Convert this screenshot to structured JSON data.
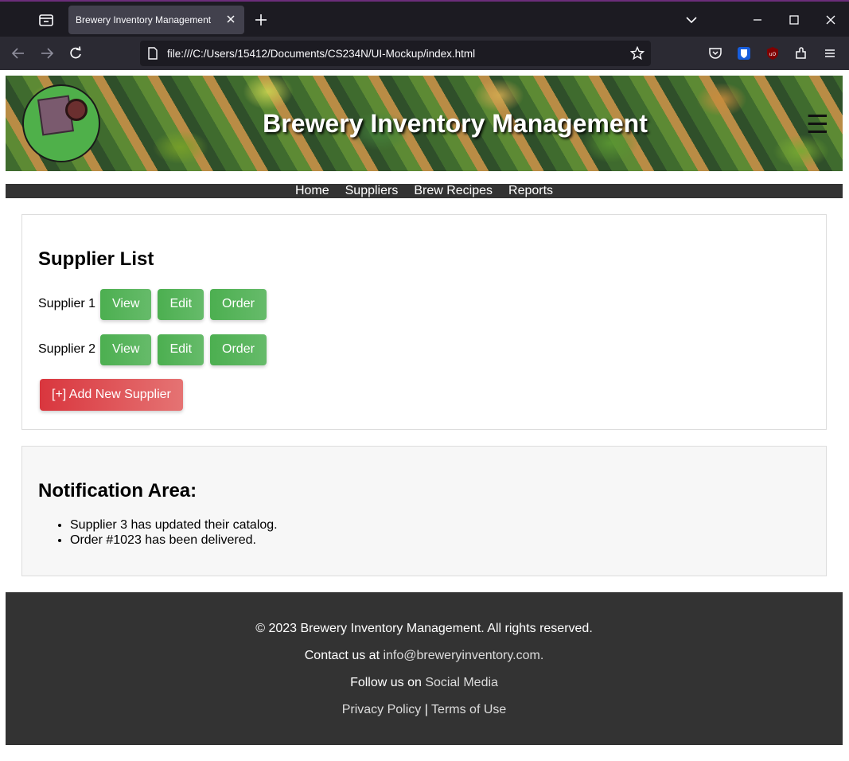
{
  "browser": {
    "tab_title": "Brewery Inventory Management",
    "url": "file:///C:/Users/15412/Documents/CS234N/UI-Mockup/index.html"
  },
  "header": {
    "title": "Brewery Inventory Management",
    "menu_glyph": "☰"
  },
  "nav": {
    "items": [
      "Home",
      "Suppliers",
      "Brew Recipes",
      "Reports"
    ]
  },
  "suppliers": {
    "heading": "Supplier List",
    "rows": [
      {
        "name": "Supplier 1",
        "view": "View",
        "edit": "Edit",
        "order": "Order"
      },
      {
        "name": "Supplier 2",
        "view": "View",
        "edit": "Edit",
        "order": "Order"
      }
    ],
    "add_label": "[+] Add New Supplier"
  },
  "notifications": {
    "heading": "Notification Area:",
    "items": [
      "Supplier 3 has updated their catalog.",
      "Order #1023 has been delivered."
    ]
  },
  "footer": {
    "copyright": "© 2023 Brewery Inventory Management. All rights reserved.",
    "contact_prefix": "Contact us at ",
    "contact_email": "info@breweryinventory.com",
    "contact_suffix": ".",
    "follow_prefix": "Follow us on ",
    "follow_link": "Social Media",
    "privacy": "Privacy Policy",
    "separator": " | ",
    "terms": "Terms of Use"
  },
  "colors": {
    "accent_green": "#4caf50",
    "accent_red": "#d9363e",
    "dark_bar": "#333333"
  }
}
